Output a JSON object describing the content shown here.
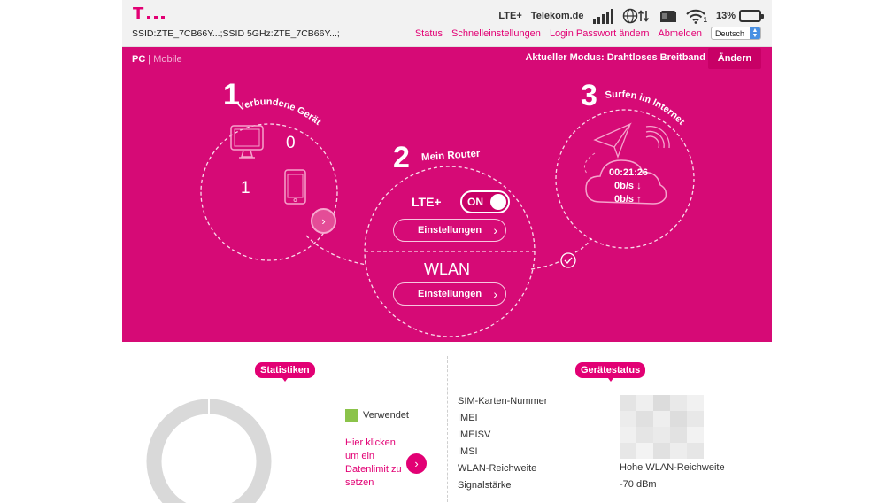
{
  "header": {
    "logo_letter": "T",
    "ssid_line": "SSID:ZTE_7CB66Y...;SSID 5GHz:ZTE_7CB66Y...;",
    "network_type": "LTE+",
    "provider": "Telekom.de",
    "wifi_clients": "1",
    "battery_percent": "13%",
    "battery_level": 0.13,
    "nav": {
      "status": "Status",
      "quick_settings": "Schnelleinstellungen",
      "login_password": "Login Passwort ändern",
      "logout": "Abmelden"
    },
    "language": "Deutsch"
  },
  "band": {
    "view_pc": "PC",
    "view_sep": "|",
    "view_mobile": "Mobile",
    "mode_label": "Aktueller Modus: Drahtloses Breitband",
    "change_button": "Ändern",
    "devices": {
      "number": "1",
      "title": "Verbundene Gerät",
      "pc_count": "0",
      "mobile_count": "1"
    },
    "router": {
      "number": "2",
      "title": "Mein Router",
      "lte_label": "LTE+",
      "toggle_label": "ON",
      "toggle_on": true,
      "settings_label": "Einstellungen",
      "wlan_label": "WLAN",
      "wlan_settings_label": "Einstellungen"
    },
    "internet": {
      "number": "3",
      "title": "Surfen im Internet",
      "duration": "00:21:26",
      "download": "0b/s ↓",
      "upload": "0b/s ↑"
    }
  },
  "stats": {
    "tag": "Statistiken",
    "legend_used": "Verwendet",
    "limit_link": "Hier klicken um ein Datenlimit zu setzen"
  },
  "device_status": {
    "tag": "Gerätestatus",
    "rows": [
      {
        "label": "SIM-Karten-Nummer"
      },
      {
        "label": "IMEI"
      },
      {
        "label": "IMEISV"
      },
      {
        "label": "IMSI"
      },
      {
        "label": "WLAN-Reichweite",
        "value": "Hohe WLAN-Reichweite"
      },
      {
        "label": "Signalstärke",
        "value": "-70 dBm"
      }
    ]
  },
  "colors": {
    "brand": "#e20074",
    "band_bg": "#d60a76",
    "used": "#8bc34a",
    "donut": "#d9d9d9"
  }
}
